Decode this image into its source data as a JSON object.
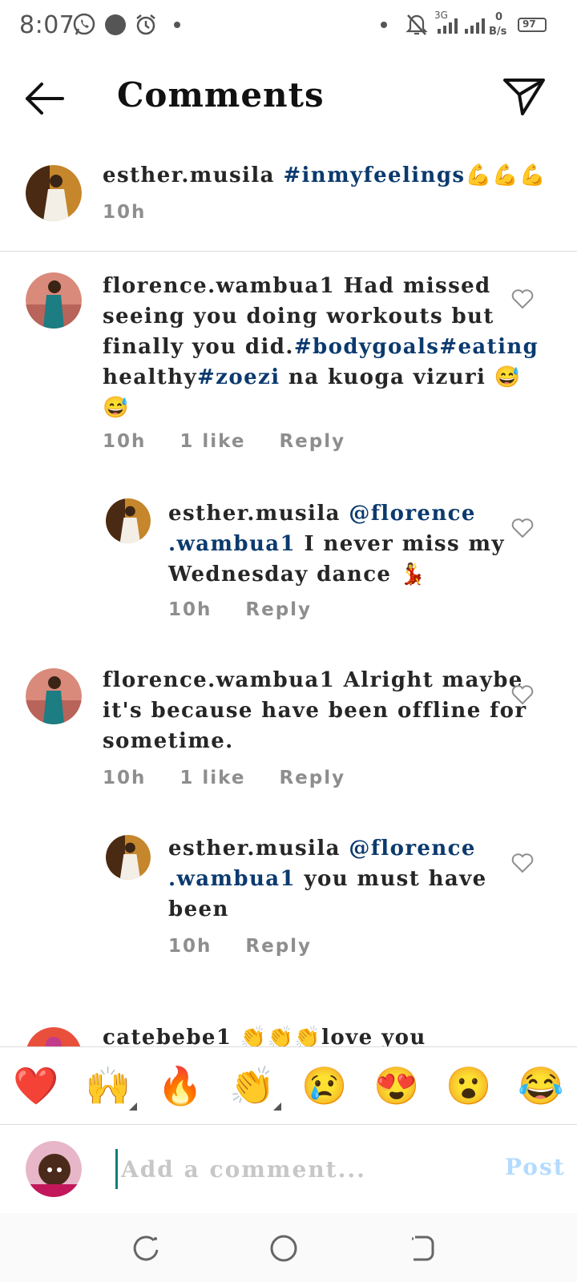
{
  "status_bar": {
    "time": "8:07",
    "network": "3G",
    "speed_value": "0",
    "speed_unit": "B/s",
    "battery": "97"
  },
  "header": {
    "title": "Comments"
  },
  "caption": {
    "username": "esther.musila",
    "text": "#inmyfeelings💪💪💪",
    "time": "10h"
  },
  "comments": [
    {
      "username": "florence.wambua1",
      "lines": [
        "Had missed",
        "seeing you doing workouts but",
        "finally you did.",
        "#bodygoals#eating",
        "healthy",
        "#zoezi",
        " na kuoga vizuri 😅",
        "😅"
      ],
      "time": "10h",
      "likes": "1 like",
      "reply": "Reply"
    },
    {
      "username": "esther.musila",
      "mention_a": "@florence",
      "mention_b": ".wambua1",
      "lines": [
        "I never miss my",
        "Wednesday dance 💃"
      ],
      "time": "10h",
      "reply": "Reply"
    },
    {
      "username": "florence.wambua1",
      "lines": [
        "Alright maybe",
        "it's because have been offline for",
        "sometime."
      ],
      "time": "10h",
      "likes": "1 like",
      "reply": "Reply"
    },
    {
      "username": "esther.musila",
      "mention_a": "@florence",
      "mention_b": ".wambua1",
      "lines": [
        "you must have",
        "been"
      ],
      "time": "10h",
      "reply": "Reply"
    },
    {
      "username": "catebebe1",
      "text": "👏👏👏love you"
    }
  ],
  "emoji_bar": [
    "❤️",
    "🙌",
    "🔥",
    "👏",
    "😢",
    "😍",
    "😮",
    "😂"
  ],
  "composer": {
    "placeholder": "Add a comment...",
    "post_label": "Post"
  },
  "colors": {
    "hashtag": "#0b3a6e",
    "meta": "#8e8e8e",
    "post_disabled": "#b3dbff"
  }
}
